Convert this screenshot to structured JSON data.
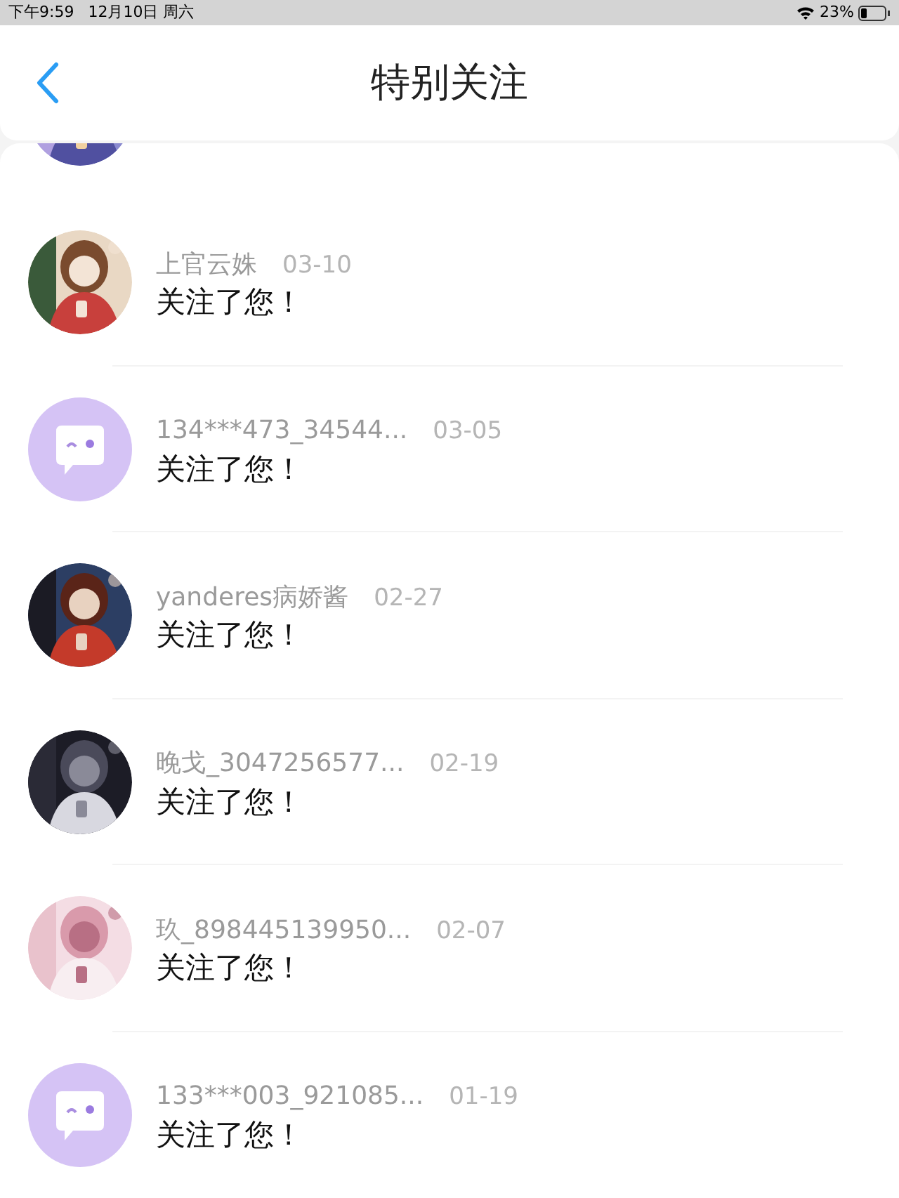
{
  "status_bar": {
    "time": "下午9:59",
    "date": "12月10日 周六",
    "battery": "23%"
  },
  "header": {
    "title": "特别关注"
  },
  "rows": [
    {
      "kind": "picture",
      "name": "上官云姝",
      "date": "03-10",
      "message": "关注了您！"
    },
    {
      "kind": "default",
      "name": "134***473_34544...",
      "date": "03-05",
      "message": "关注了您！"
    },
    {
      "kind": "picture",
      "name": "yanderes病娇酱",
      "date": "02-27",
      "message": "关注了您！"
    },
    {
      "kind": "picture",
      "name": "晚戈_3047256577...",
      "date": "02-19",
      "message": "关注了您！"
    },
    {
      "kind": "picture",
      "name": "玖_898445139950...",
      "date": "02-07",
      "message": "关注了您！"
    },
    {
      "kind": "default",
      "name": "133***003_921085...",
      "date": "01-19",
      "message": "关注了您！"
    }
  ]
}
